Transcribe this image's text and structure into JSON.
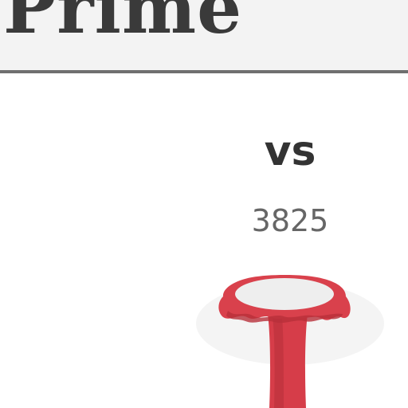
{
  "header": {
    "title": "Prime"
  },
  "comparison": {
    "vs_label": "vs",
    "score": "3825"
  },
  "product": {
    "icon": "red-stool-image",
    "colors": {
      "body": "#d9414c",
      "shadow": "#b8303a",
      "seat_top": "#eeeeee"
    }
  }
}
